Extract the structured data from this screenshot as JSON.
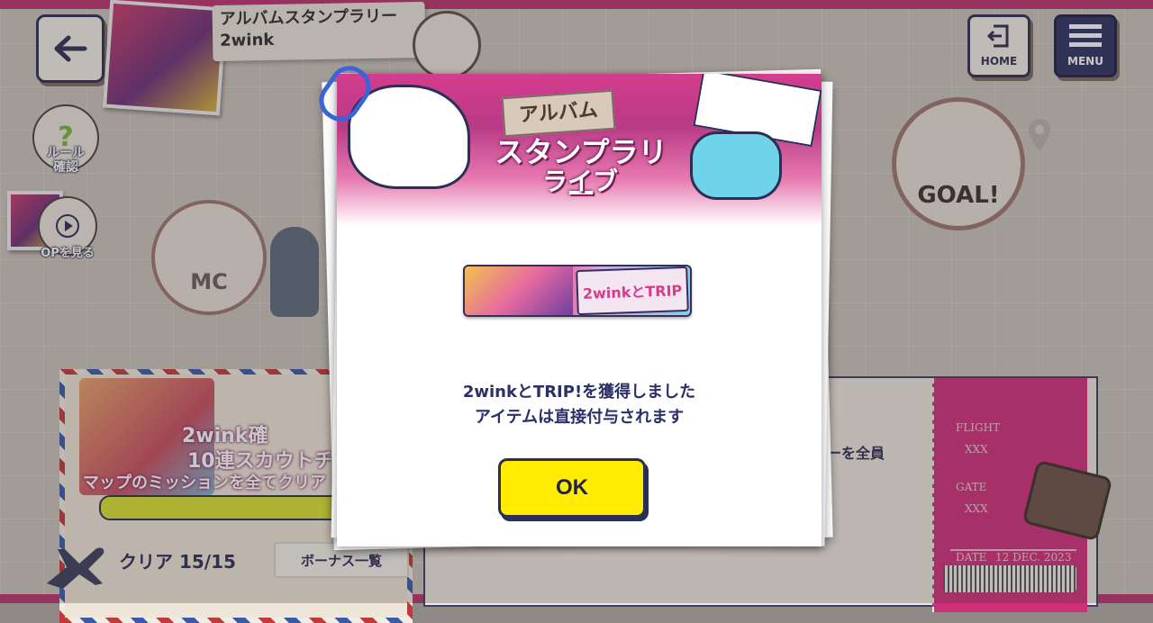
{
  "header": {
    "title_line1": "アルバムスタンプラリー",
    "title_line2": "2wink"
  },
  "nav": {
    "home_label": "HOME",
    "menu_label": "MENU"
  },
  "side": {
    "rules_line1": "ルール",
    "rules_line2": "確認",
    "op_label": "OPを見る"
  },
  "map": {
    "mc_label": "MC",
    "goal_label": "GOAL!"
  },
  "scout_card": {
    "title_line1": "2wink確",
    "title_line2": "10連スカウトチ",
    "subtitle": "マップのミッションを全てクリア",
    "clear_text": "クリア 15/15",
    "bonus_button": "ボーナス一覧"
  },
  "member_card": {
    "text": "バーを全員"
  },
  "ticket": {
    "flight_label": "FLIGHT",
    "flight_value": "XXX",
    "gate_label": "GATE",
    "gate_value": "XXX",
    "date_label": "DATE",
    "date_value": "12 DEC. 2023"
  },
  "modal": {
    "banner_line1": "アルバム",
    "banner_line2": "スタンプラリー",
    "banner_line3": "ライブ",
    "item_badge_text": "2winkとTRIP",
    "message_line1": "2winkとTRIP!を獲得しました",
    "message_line2": "アイテムは直接付与されます",
    "ok_label": "OK"
  }
}
